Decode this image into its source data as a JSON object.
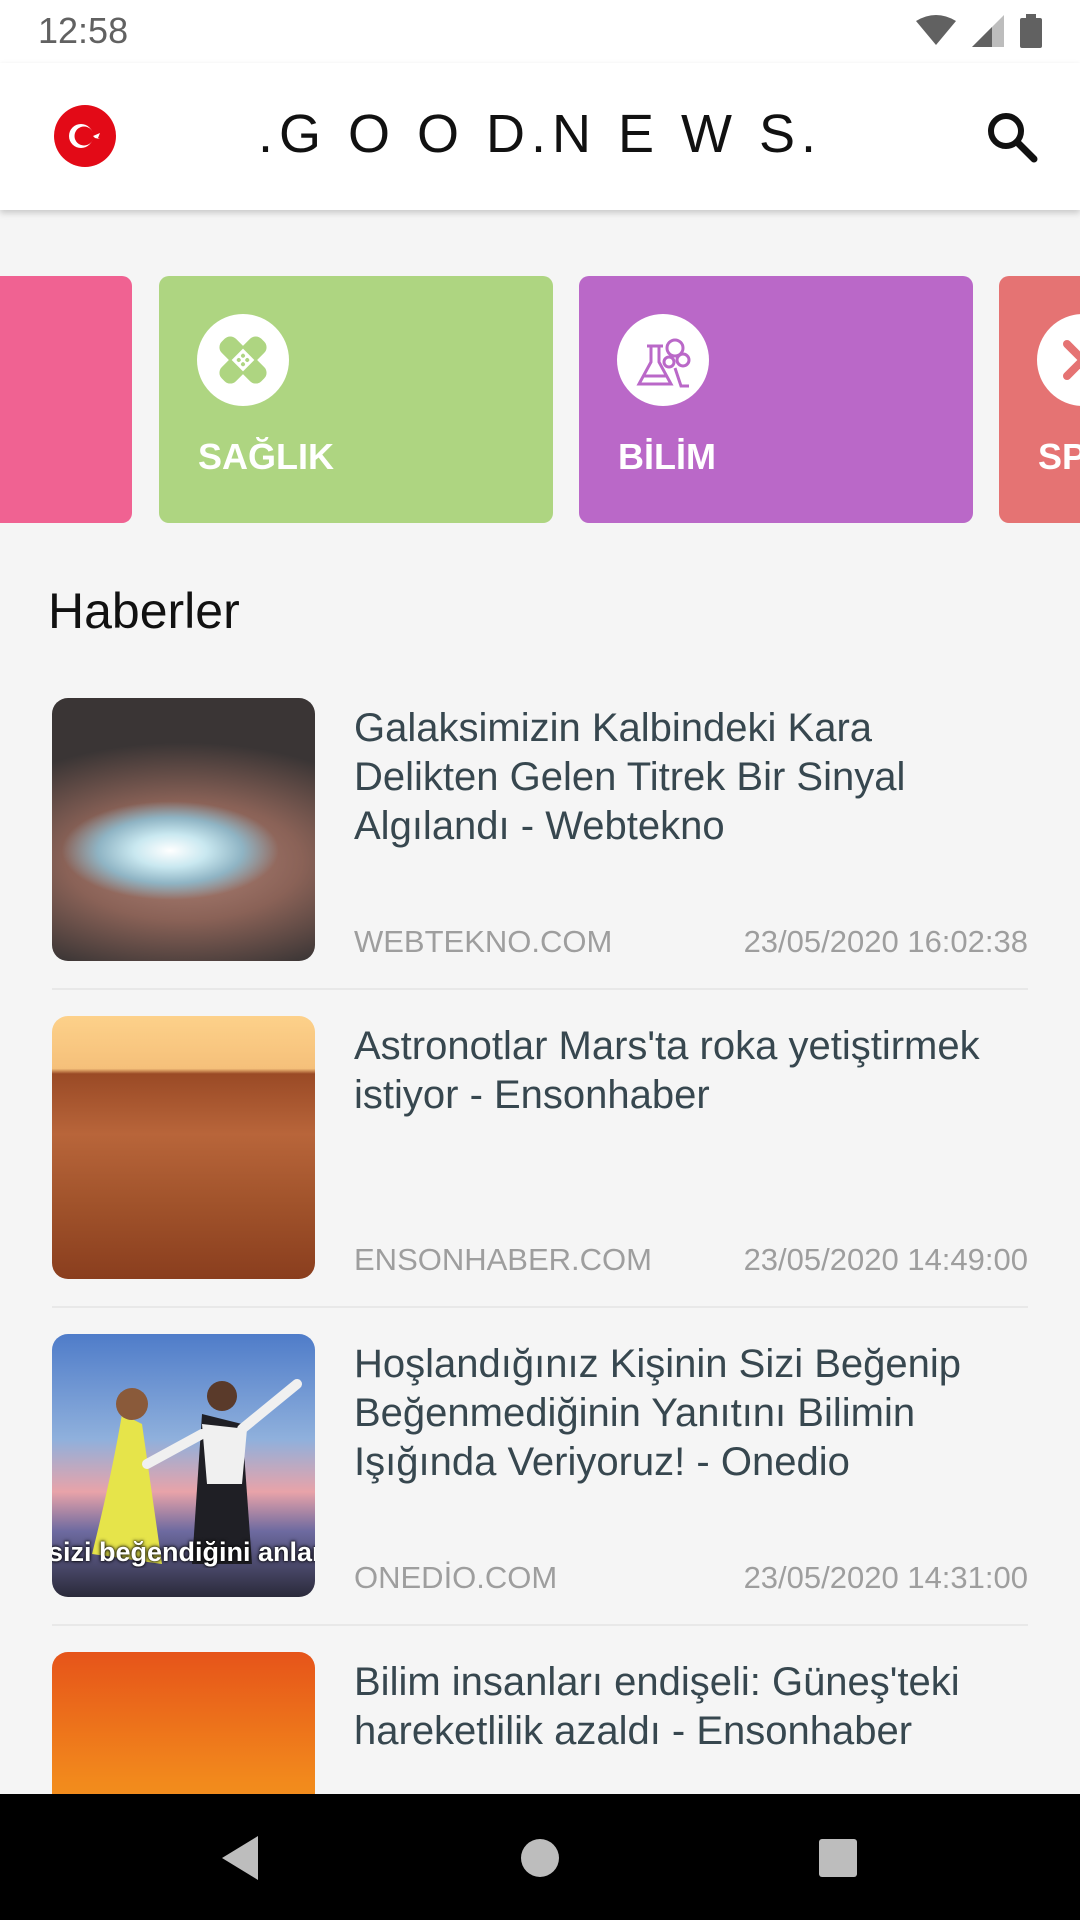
{
  "status_bar": {
    "time": "12:58"
  },
  "app_bar": {
    "title": ".G O O D.N E W S."
  },
  "categories": [
    {
      "label": "",
      "color": "#f06292"
    },
    {
      "label": "SAĞLIK",
      "color": "#aed581",
      "icon": "bandage-icon"
    },
    {
      "label": "BİLİM",
      "color": "#ba68c8",
      "icon": "flask-icon"
    },
    {
      "label": "SP",
      "color": "#e57373",
      "icon": "x-icon"
    }
  ],
  "section_title": "Haberler",
  "news": [
    {
      "title": "Galaksimizin Kalbindeki Kara Delikten Gelen Titrek Bir Sinyal Algılandı - Webtekno",
      "source": "WEBTEKNO.COM",
      "date": "23/05/2020 16:02:38"
    },
    {
      "title": "Astronotlar Mars'ta roka yetiştirmek istiyor - Ensonhaber",
      "source": "ENSONHABER.COM",
      "date": "23/05/2020 14:49:00"
    },
    {
      "title": "Hoşlandığınız Kişinin Sizi Beğenip Beğenmediğinin Yanıtını Bilimin Işığında Veriyoruz! - Onedio",
      "source": "ONEDİO.COM",
      "date": "23/05/2020 14:31:00",
      "thumb_caption": "sizi beğendiğini anlama"
    },
    {
      "title": "Bilim insanları endişeli: Güneş'teki hareketlilik azaldı - Ensonhaber",
      "source": "",
      "date": ""
    }
  ],
  "colors": {
    "accent_red": "#e30a17",
    "text_dark": "#37474f",
    "text_muted": "#9e9e9e"
  }
}
